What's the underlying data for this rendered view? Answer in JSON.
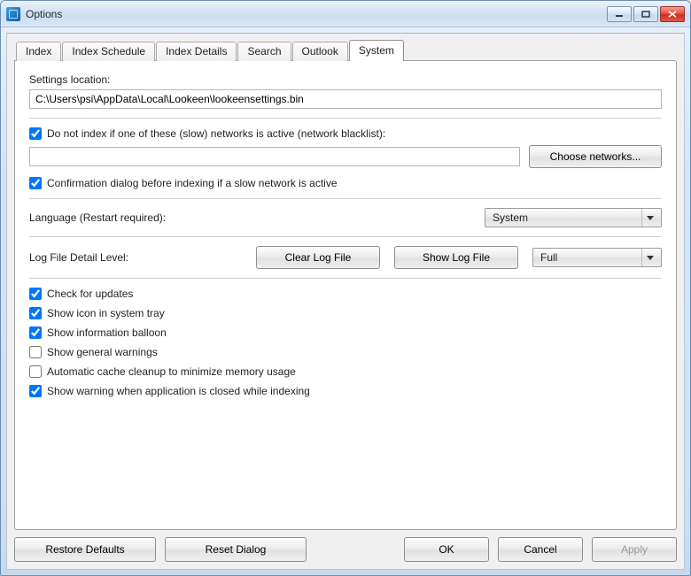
{
  "window": {
    "title": "Options"
  },
  "tabs": [
    {
      "label": "Index"
    },
    {
      "label": "Index Schedule"
    },
    {
      "label": "Index Details"
    },
    {
      "label": "Search"
    },
    {
      "label": "Outlook"
    },
    {
      "label": "System"
    }
  ],
  "system": {
    "settings_location_label": "Settings location:",
    "settings_location_value": "C:\\Users\\psi\\AppData\\Local\\Lookeen\\lookeensettings.bin",
    "blacklist_checkbox_label": "Do not index if one of these (slow) networks is active (network blacklist):",
    "blacklist_checked": true,
    "blacklist_value": "",
    "choose_networks_label": "Choose networks...",
    "confirm_checkbox_label": "Confirmation dialog before indexing if a slow network is active",
    "confirm_checked": true,
    "language_label": "Language (Restart required):",
    "language_value": "System",
    "log_level_label": "Log File Detail Level:",
    "clear_log_label": "Clear Log File",
    "show_log_label": "Show Log File",
    "log_level_value": "Full",
    "checks": [
      {
        "label": "Check for updates",
        "checked": true
      },
      {
        "label": "Show icon in system tray",
        "checked": true
      },
      {
        "label": "Show information balloon",
        "checked": true
      },
      {
        "label": "Show general warnings",
        "checked": false
      },
      {
        "label": "Automatic cache cleanup to minimize memory usage",
        "checked": false
      },
      {
        "label": "Show warning when application is closed while indexing",
        "checked": true
      }
    ]
  },
  "buttons": {
    "restore_defaults": "Restore Defaults",
    "reset_dialog": "Reset Dialog",
    "ok": "OK",
    "cancel": "Cancel",
    "apply": "Apply"
  }
}
